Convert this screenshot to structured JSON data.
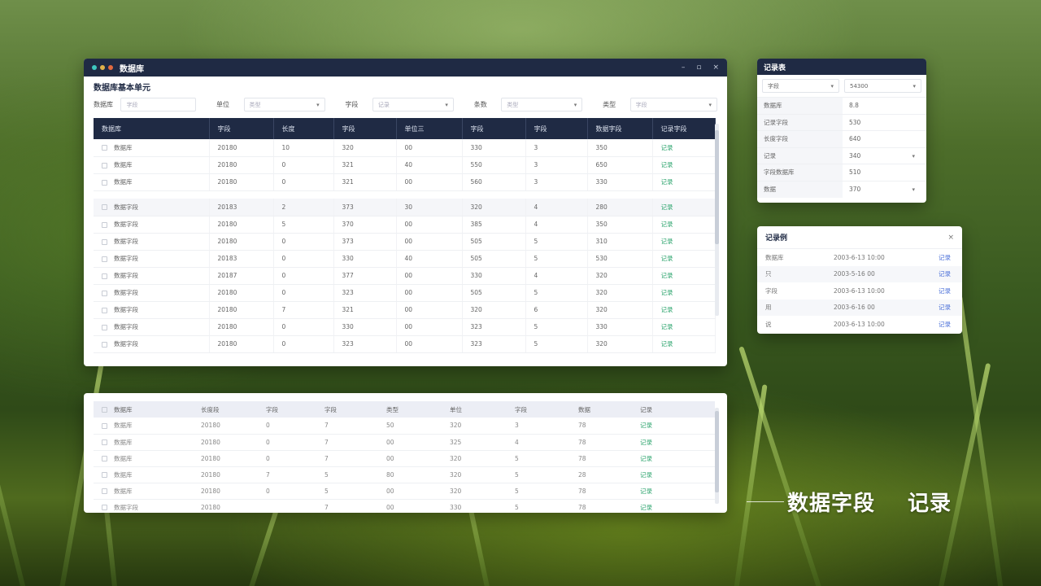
{
  "main_window": {
    "title": "数据库",
    "dot_colors": [
      "#3ec7c0",
      "#e0b24a",
      "#e26a3f"
    ],
    "controls": [
      "–",
      "▫",
      "×"
    ],
    "section_title": "数据库基本单元",
    "filters": [
      {
        "label": "数据库",
        "placeholder": "字段",
        "type": "input"
      },
      {
        "label": "单位",
        "placeholder": "类型",
        "type": "select"
      },
      {
        "label": "字段",
        "placeholder": "记录",
        "type": "select"
      },
      {
        "label": "条数",
        "placeholder": "类型",
        "type": "select"
      },
      {
        "label": "类型",
        "placeholder": "字段",
        "type": "select"
      }
    ],
    "columns": [
      "数据库",
      "字段",
      "长度",
      "字段",
      "单位三",
      "字段",
      "字段",
      "数据字段",
      "记录字段"
    ],
    "rows_top": [
      [
        "数据库",
        "20180",
        "10",
        "320",
        "00",
        "330",
        "3",
        "350",
        "记录"
      ],
      [
        "数据库",
        "20180",
        "0",
        "321",
        "40",
        "550",
        "3",
        "650",
        "记录"
      ],
      [
        "数据库",
        "20180",
        "0",
        "321",
        "00",
        "560",
        "3",
        "330",
        "记录"
      ]
    ],
    "rows_bottom": [
      [
        "数据字段",
        "20183",
        "2",
        "373",
        "30",
        "320",
        "4",
        "280",
        "记录"
      ],
      [
        "数据字段",
        "20180",
        "5",
        "370",
        "00",
        "385",
        "4",
        "350",
        "记录"
      ],
      [
        "数据字段",
        "20180",
        "0",
        "373",
        "00",
        "505",
        "5",
        "310",
        "记录"
      ],
      [
        "数据字段",
        "20183",
        "0",
        "330",
        "40",
        "505",
        "5",
        "530",
        "记录"
      ],
      [
        "数据字段",
        "20187",
        "0",
        "377",
        "00",
        "330",
        "4",
        "320",
        "记录"
      ],
      [
        "数据字段",
        "20180",
        "0",
        "323",
        "00",
        "505",
        "5",
        "320",
        "记录"
      ],
      [
        "数据字段",
        "20180",
        "7",
        "321",
        "00",
        "320",
        "6",
        "320",
        "记录"
      ],
      [
        "数据字段",
        "20180",
        "0",
        "330",
        "00",
        "323",
        "5",
        "330",
        "记录"
      ],
      [
        "数据字段",
        "20180",
        "0",
        "323",
        "00",
        "323",
        "5",
        "320",
        "记录"
      ]
    ]
  },
  "second_window": {
    "columns": [
      "数据库",
      "长度段",
      "字段",
      "字段",
      "类型",
      "单位",
      "字段",
      "数据",
      "记录"
    ],
    "rows": [
      [
        "数据库",
        "20180",
        "0",
        "7",
        "50",
        "320",
        "3",
        "78",
        "记录"
      ],
      [
        "数据库",
        "20180",
        "0",
        "7",
        "00",
        "325",
        "4",
        "78",
        "记录"
      ],
      [
        "数据库",
        "20180",
        "0",
        "7",
        "00",
        "320",
        "5",
        "78",
        "记录"
      ],
      [
        "数据库",
        "20180",
        "7",
        "5",
        "80",
        "320",
        "5",
        "28",
        "记录"
      ],
      [
        "数据库",
        "20180",
        "0",
        "5",
        "00",
        "320",
        "5",
        "78",
        "记录"
      ],
      [
        "数据字段",
        "20180",
        "",
        "7",
        "00",
        "330",
        "5",
        "78",
        "记录"
      ]
    ]
  },
  "record_panel": {
    "title": "记录表",
    "select_left": "字段",
    "select_right": "54300",
    "rows": [
      {
        "key": "数据库",
        "value": "8.8",
        "dropdown": false
      },
      {
        "key": "记录字段",
        "value": "530",
        "dropdown": false
      },
      {
        "key": "长度字段",
        "value": "640",
        "dropdown": false
      },
      {
        "key": "记录",
        "value": "340",
        "dropdown": true
      },
      {
        "key": "字段数据库",
        "value": "510",
        "dropdown": false
      },
      {
        "key": "数据",
        "value": "370",
        "dropdown": true
      }
    ]
  },
  "log_panel": {
    "title": "记录例",
    "close": "×",
    "rows": [
      {
        "name": "数据库",
        "time": "2003-6-13 10:00",
        "action": "记录"
      },
      {
        "name": "只",
        "time": "2003-5-16 00",
        "action": "记录"
      },
      {
        "name": "字段",
        "time": "2003-6-13 10:00",
        "action": "记录"
      },
      {
        "name": "用",
        "time": "2003-6-16 00",
        "action": "记录"
      },
      {
        "name": "说",
        "time": "2003-6-13 10:00",
        "action": "记录"
      }
    ]
  },
  "caption": {
    "left": "数据字段",
    "right": "记录"
  },
  "colors": {
    "navy": "#1f2a44",
    "action_green": "#2fa56f",
    "link_blue": "#4a6fd8"
  }
}
